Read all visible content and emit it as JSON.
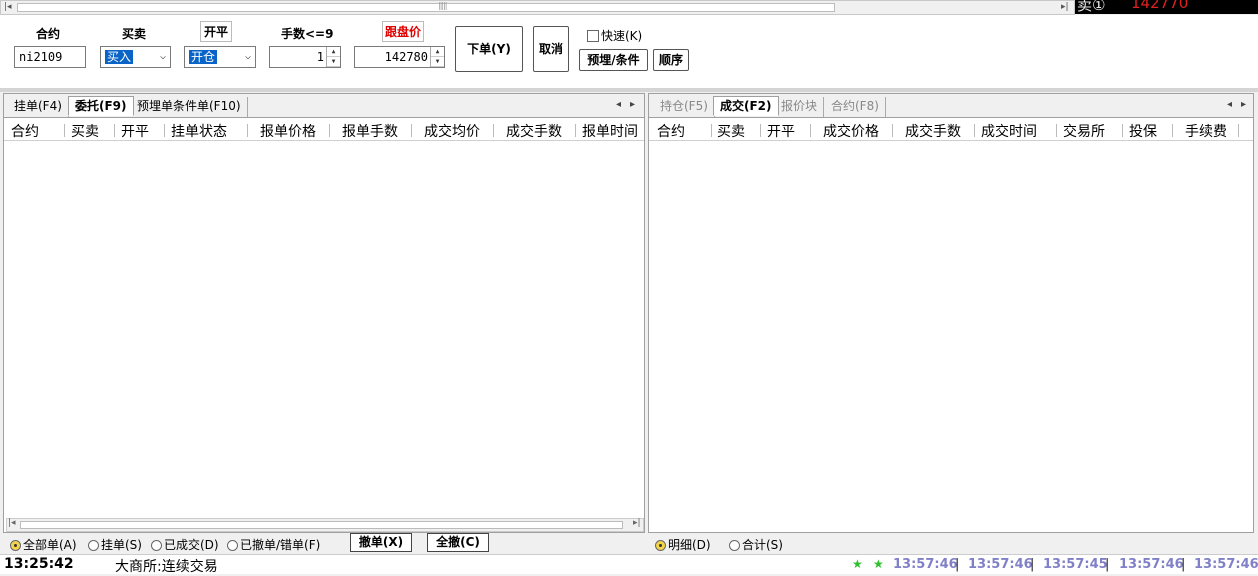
{
  "quote": {
    "side": "卖①",
    "price": "142770"
  },
  "order": {
    "contract_label": "合约",
    "contract_value": "ni2109",
    "side_label": "买卖",
    "side_value": "买入",
    "openclose_label": "开平",
    "openclose_value": "开仓",
    "qty_label": "手数<=9",
    "qty_value": "1",
    "price_label": "跟盘价",
    "price_value": "142780",
    "submit_label": "下单(Y)",
    "cancel_label": "取消",
    "fast_label": "快速(K)",
    "preset_label": "预埋/条件",
    "sequence_label": "顺序",
    "price_label_color": "#e00000"
  },
  "left_panel": {
    "tabs": [
      "挂单(F4)",
      "委托(F9)",
      "预埋单条件单(F10)"
    ],
    "active_tab": 1,
    "columns": [
      "合约",
      "买卖",
      "开平",
      "挂单状态",
      "报单价格",
      "报单手数",
      "成交均价",
      "成交手数",
      "报单时间"
    ],
    "filters": [
      "全部单(A)",
      "挂单(S)",
      "已成交(D)",
      "已撤单/错单(F)"
    ],
    "selected_filter": 0,
    "cancel_order_label": "撤单(X)",
    "cancel_all_label": "全撤(C)"
  },
  "right_panel": {
    "tabs": [
      "持仓(F5)",
      "成交(F2)",
      "报价块",
      "合约(F8)"
    ],
    "active_tab": 1,
    "columns": [
      "合约",
      "买卖",
      "开平",
      "成交价格",
      "成交手数",
      "成交时间",
      "交易所",
      "投保",
      "手续费"
    ],
    "filters": [
      "明细(D)",
      "合计(S)"
    ],
    "selected_filter": 0
  },
  "status": {
    "clock": "13:25:42",
    "exchange_text": "大商所:连续交易",
    "times": [
      "13:57:46",
      "13:57:46",
      "13:57:45",
      "13:57:46",
      "13:57:46"
    ],
    "star_color": "#2ec02e"
  }
}
